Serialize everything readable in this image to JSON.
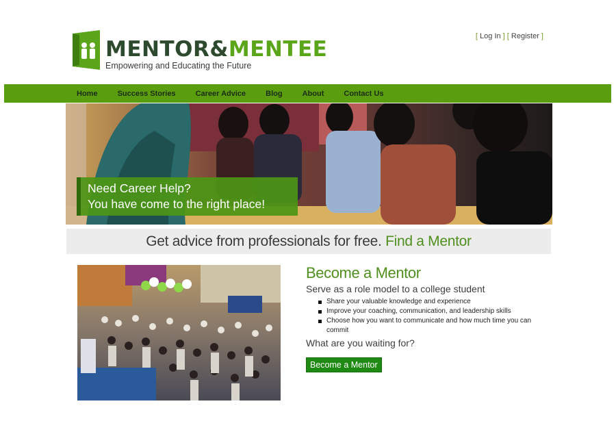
{
  "brand": {
    "name_part1": "MENTOR",
    "name_amp": "&",
    "name_part2": "MENTEE",
    "tagline": "Empowering and Educating the Future",
    "colors": {
      "dark": "#2e4a2e",
      "green": "#5aa51a"
    }
  },
  "auth": {
    "login": "Log In",
    "register": "Register"
  },
  "nav": {
    "items": [
      "Home",
      "Success Stories",
      "Career Advice",
      "Blog",
      "About",
      "Contact Us"
    ],
    "background": "#5a9e10"
  },
  "hero": {
    "line1": "Need Career Help?",
    "line2": "You have come to the right place!"
  },
  "banner": {
    "text": "Get advice from professionals for free.",
    "link": "Find a Mentor"
  },
  "become": {
    "title": "Become a Mentor",
    "subtitle": "Serve as a role model to a college student",
    "bullets": [
      "Share your valuable knowledge and experience",
      "Improve your coaching, communication, and leadership skills",
      "Choose how you want to communicate and how much time you can commit"
    ],
    "question": "What are you waiting for?",
    "button": "Become a Mentor"
  }
}
